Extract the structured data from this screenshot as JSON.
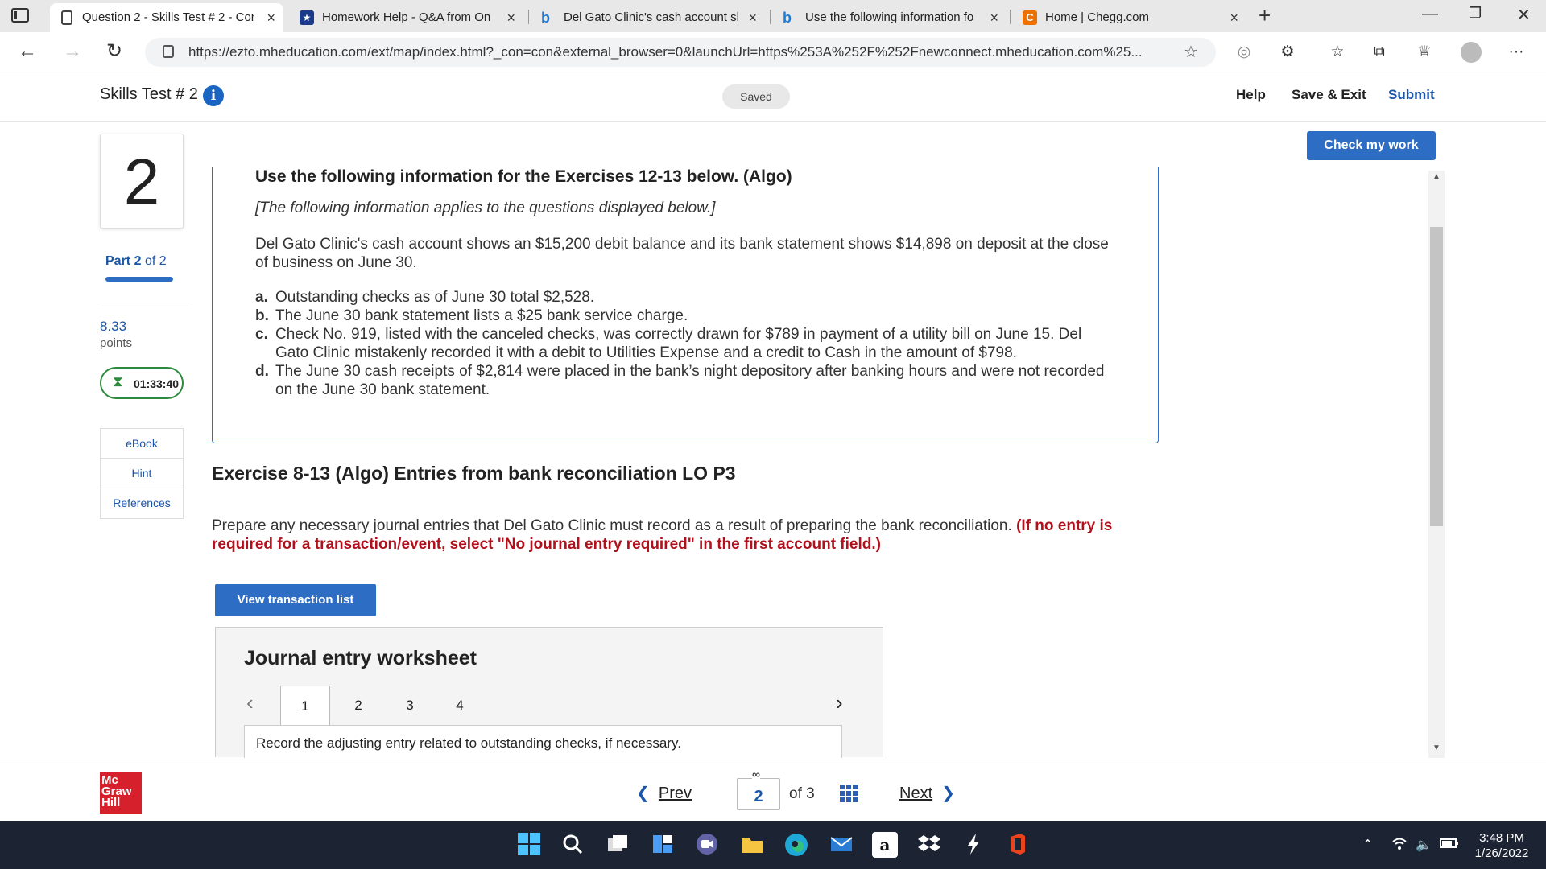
{
  "browser": {
    "tabs": [
      {
        "title": "Question 2 - Skills Test # 2 - Con",
        "active": true
      },
      {
        "title": "Homework Help - Q&A from On"
      },
      {
        "title": "Del Gato Clinic's cash account sh"
      },
      {
        "title": "Use the following information fo"
      },
      {
        "title": "Home | Chegg.com"
      }
    ],
    "url": "https://ezto.mheducation.com/ext/map/index.html?_con=con&external_browser=0&launchUrl=https%253A%252F%252Fnewconnect.mheducation.com%25..."
  },
  "header": {
    "test_title": "Skills Test # 2",
    "info_glyph": "i",
    "saved": "Saved",
    "help": "Help",
    "save_exit": "Save & Exit",
    "submit": "Submit"
  },
  "rail": {
    "question_number": "2",
    "part_word": "Part",
    "part_current": "2",
    "part_total": "of 2",
    "points_value": "8.33",
    "points_label": "points",
    "timer": "01:33:40",
    "tools": [
      "eBook",
      "Hint",
      "References"
    ]
  },
  "main": {
    "check_my_work": "Check my work",
    "panel_title": "Use the following information for the Exercises 12-13 below. (Algo)",
    "panel_subtitle": "[The following information applies to the questions displayed below.]",
    "panel_body": "Del Gato Clinic's cash account shows an $15,200 debit balance and its bank statement shows $14,898 on deposit at the close of business on June 30.",
    "items": [
      {
        "letter": "a.",
        "text": "Outstanding checks as of June 30 total $2,528."
      },
      {
        "letter": "b.",
        "text": "The June 30 bank statement lists a $25 bank service charge."
      },
      {
        "letter": "c.",
        "text": "Check No. 919, listed with the canceled checks, was correctly drawn for $789 in payment of a utility bill on June 15. Del Gato Clinic mistakenly recorded it with a debit to Utilities Expense and a credit to Cash in the amount of $798."
      },
      {
        "letter": "d.",
        "text": "The June 30 cash receipts of $2,814 were placed in the bank’s night depository after banking hours and were not recorded on the June 30 bank statement."
      }
    ],
    "exercise_title": "Exercise 8-13 (Algo) Entries from bank reconciliation LO P3",
    "instructions": "Prepare any necessary journal entries that Del Gato Clinic must record as a result of preparing the bank reconciliation.",
    "instructions_note": "(If no entry is required for a transaction/event, select \"No journal entry required\" in the first account field.)",
    "view_transactions": "View transaction list",
    "worksheet": {
      "title": "Journal entry worksheet",
      "tabs": [
        "1",
        "2",
        "3",
        "4"
      ],
      "active_tab": "1",
      "prompt": "Record the adjusting entry related to outstanding checks, if necessary."
    }
  },
  "footer": {
    "logo": [
      "Mc",
      "Graw",
      "Hill"
    ],
    "prev": "Prev",
    "page": "2",
    "of": "of 3",
    "next": "Next"
  },
  "taskbar": {
    "time": "3:48 PM",
    "date": "1/26/2022",
    "amazon_glyph": "a"
  },
  "colors": {
    "brand_blue": "#2d6ec4",
    "link_blue": "#1a55a8",
    "note_red": "#b0111c",
    "timer_green": "#2e8b3d",
    "mh_red": "#d6202b"
  }
}
